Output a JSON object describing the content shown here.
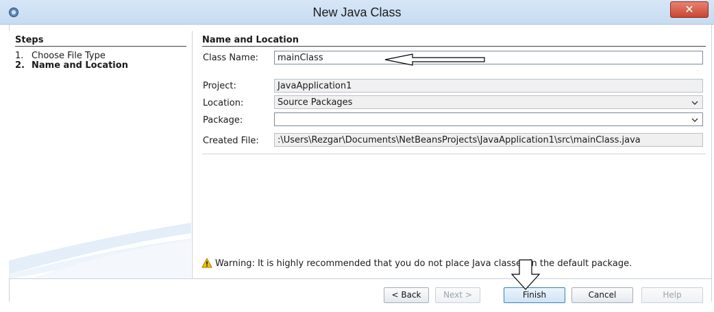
{
  "window": {
    "title": "New Java Class",
    "close_label": "✕"
  },
  "steps": {
    "title": "Steps",
    "items": [
      {
        "num": "1.",
        "label": "Choose File Type"
      },
      {
        "num": "2.",
        "label": "Name and Location"
      }
    ]
  },
  "form": {
    "section_title": "Name and Location",
    "class_name": {
      "label": "Class Name:",
      "value": "mainClass"
    },
    "project": {
      "label": "Project:",
      "value": "JavaApplication1"
    },
    "location": {
      "label": "Location:",
      "value": "Source Packages"
    },
    "package": {
      "label": "Package:",
      "value": ""
    },
    "created_file": {
      "label": "Created File:",
      "value": ":\\Users\\Rezgar\\Documents\\NetBeansProjects\\JavaApplication1\\src\\mainClass.java"
    }
  },
  "warning": {
    "text": "Warning: It is highly recommended that you do not place Java classes in the default package.",
    "icon": "warning-icon"
  },
  "buttons": {
    "back": "< Back",
    "next": "Next >",
    "finish": "Finish",
    "cancel": "Cancel",
    "help": "Help"
  },
  "colors": {
    "titlebar": "#c7dbf1",
    "close_button": "#c94633",
    "warning_icon": "#f2c200",
    "annotation_arrow": "#000000"
  }
}
